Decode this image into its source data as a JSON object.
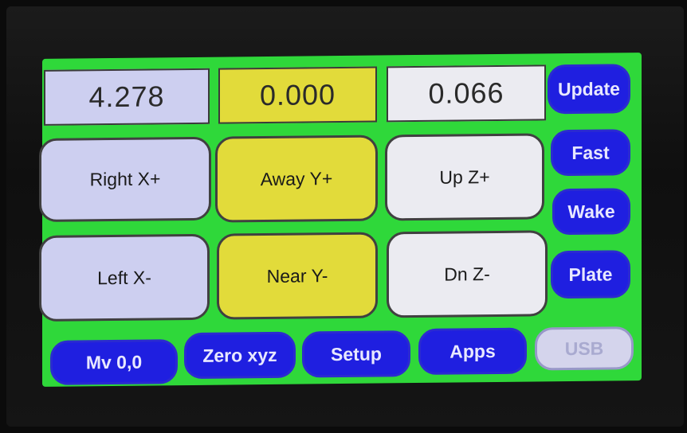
{
  "readouts": {
    "x": "4.278",
    "y": "0.000",
    "z": "0.066"
  },
  "jog": {
    "x_plus": "Right X+",
    "x_minus": "Left X-",
    "y_plus": "Away Y+",
    "y_minus": "Near Y-",
    "z_plus": "Up Z+",
    "z_minus": "Dn Z-"
  },
  "side_buttons": {
    "update": "Update",
    "fast": "Fast",
    "wake": "Wake",
    "plate": "Plate"
  },
  "bottom_buttons": {
    "move_origin": "Mv 0,0",
    "zero": "Zero xyz",
    "setup": "Setup",
    "apps": "Apps",
    "usb": "USB"
  },
  "colors": {
    "background": "#2fd83a",
    "x_axis": "#cdcff0",
    "y_axis": "#e2db3a",
    "z_axis": "#ebebf1",
    "button_blue": "#1f1fe0"
  }
}
